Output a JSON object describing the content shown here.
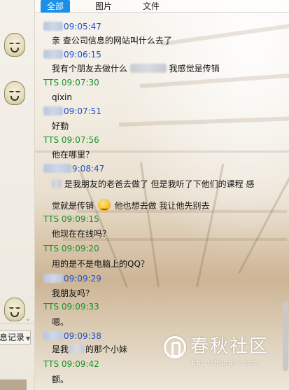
{
  "tabs": [
    {
      "label": "全部",
      "active": true
    },
    {
      "label": "图片",
      "active": false
    },
    {
      "label": "文件",
      "active": false
    }
  ],
  "sidebar": {
    "history_label": "息记录",
    "history_arrow": "▼",
    "collapse_arrow": "⌄"
  },
  "messages": [
    {
      "sender": "",
      "time": "09:05:47",
      "text": "亲 查公司信息的网站叫什么去了"
    },
    {
      "sender": "",
      "time": "09:06:15",
      "text_before": "我有个朋友去做什么",
      "text_after": "我感觉是传销"
    },
    {
      "sender": "TTS",
      "time": "09:07:30",
      "text": "qixin"
    },
    {
      "sender": "",
      "time": "09:07:51",
      "text": "好勤"
    },
    {
      "sender": "TTS",
      "time": "09:07:56",
      "text": "他在哪里？"
    },
    {
      "sender": "",
      "time": "9:08:47",
      "text_line1": "是我朋友的老爸去做了 但是我听了下他们的课程 感",
      "text_line2_before": "觉就是传销",
      "text_line2_after": "他也想去做 我让他先别去"
    },
    {
      "sender": "TTS",
      "time": "09:09:15",
      "text": "他现在在线吗？"
    },
    {
      "sender": "TTS",
      "time": "09:09:20",
      "text": "用的是不是电脑上的QQ？"
    },
    {
      "sender": "",
      "time": "09:09:29",
      "text": "我朋友吗？"
    },
    {
      "sender": "TTS",
      "time": "09:09:33",
      "text": "嗯。"
    },
    {
      "sender": "",
      "time": "09:09:38",
      "text_before": "是我",
      "text_after": "的那个小妹"
    },
    {
      "sender": "TTS",
      "time": "09:09:42",
      "text": "额。"
    }
  ],
  "watermark": {
    "name": "春秋社区",
    "url": "bbs.ichunqiu.com"
  },
  "colors": {
    "tab_active": "#1c8fe8",
    "time_other": "#1f4fd1",
    "time_self": "#19922a"
  },
  "icons": [
    "avatar-face-icon",
    "dropdown-arrow-icon",
    "emoji-laugh-icon",
    "ichunqiu-logo-icon"
  ]
}
